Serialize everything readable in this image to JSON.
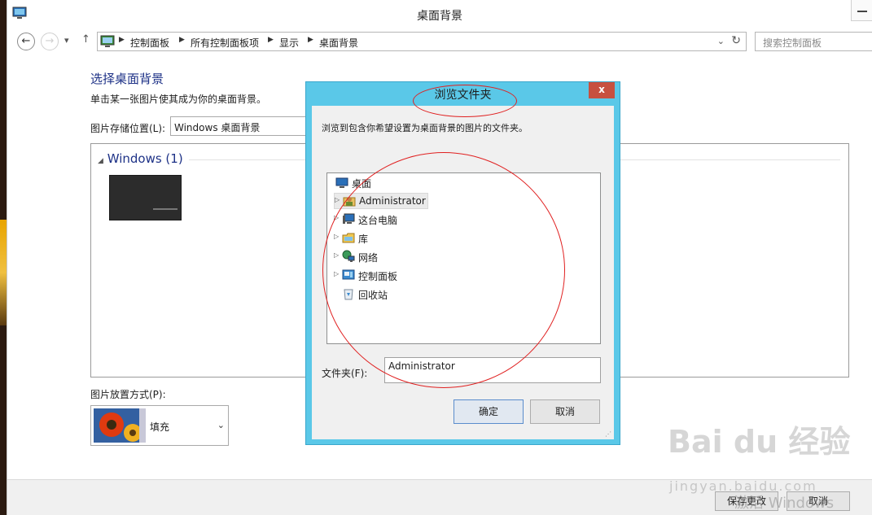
{
  "window": {
    "title": "桌面背景"
  },
  "address": {
    "crumbs": [
      "控制面板",
      "所有控制面板项",
      "显示",
      "桌面背景"
    ],
    "search_placeholder": "搜索控制面板"
  },
  "main": {
    "heading": "选择桌面背景",
    "subtext": "单击某一张图片使其成为你的桌面背景。",
    "location_label": "图片存储位置(L):",
    "location_value": "Windows 桌面背景",
    "group_title": "Windows (1)",
    "position_label": "图片放置方式(P):",
    "position_value": "填充"
  },
  "footer": {
    "save_label": "保存更改",
    "cancel_label": "取消"
  },
  "dialog": {
    "title": "浏览文件夹",
    "close_label": "x",
    "instruction": "浏览到包含你希望设置为桌面背景的图片的文件夹。",
    "tree": [
      {
        "label": "桌面",
        "icon": "desktop-icon",
        "expandable": false
      },
      {
        "label": "Administrator",
        "icon": "user-folder-icon",
        "expandable": true,
        "selected": true
      },
      {
        "label": "这台电脑",
        "icon": "computer-icon",
        "expandable": true
      },
      {
        "label": "库",
        "icon": "library-icon",
        "expandable": true
      },
      {
        "label": "网络",
        "icon": "network-icon",
        "expandable": true
      },
      {
        "label": "控制面板",
        "icon": "control-panel-icon",
        "expandable": true
      },
      {
        "label": "回收站",
        "icon": "recycle-bin-icon",
        "expandable": false
      }
    ],
    "folder_label": "文件夹(F):",
    "folder_value": "Administrator",
    "ok_label": "确定",
    "cancel_label": "取消"
  },
  "watermark": {
    "brand": "Bai du 经验",
    "url": "jingyan.baidu.com",
    "overlay_text": "激活 Windows"
  },
  "colors": {
    "dialog_frame": "#5ac8e8",
    "heading": "#1e3287",
    "annotation": "#e02020"
  }
}
